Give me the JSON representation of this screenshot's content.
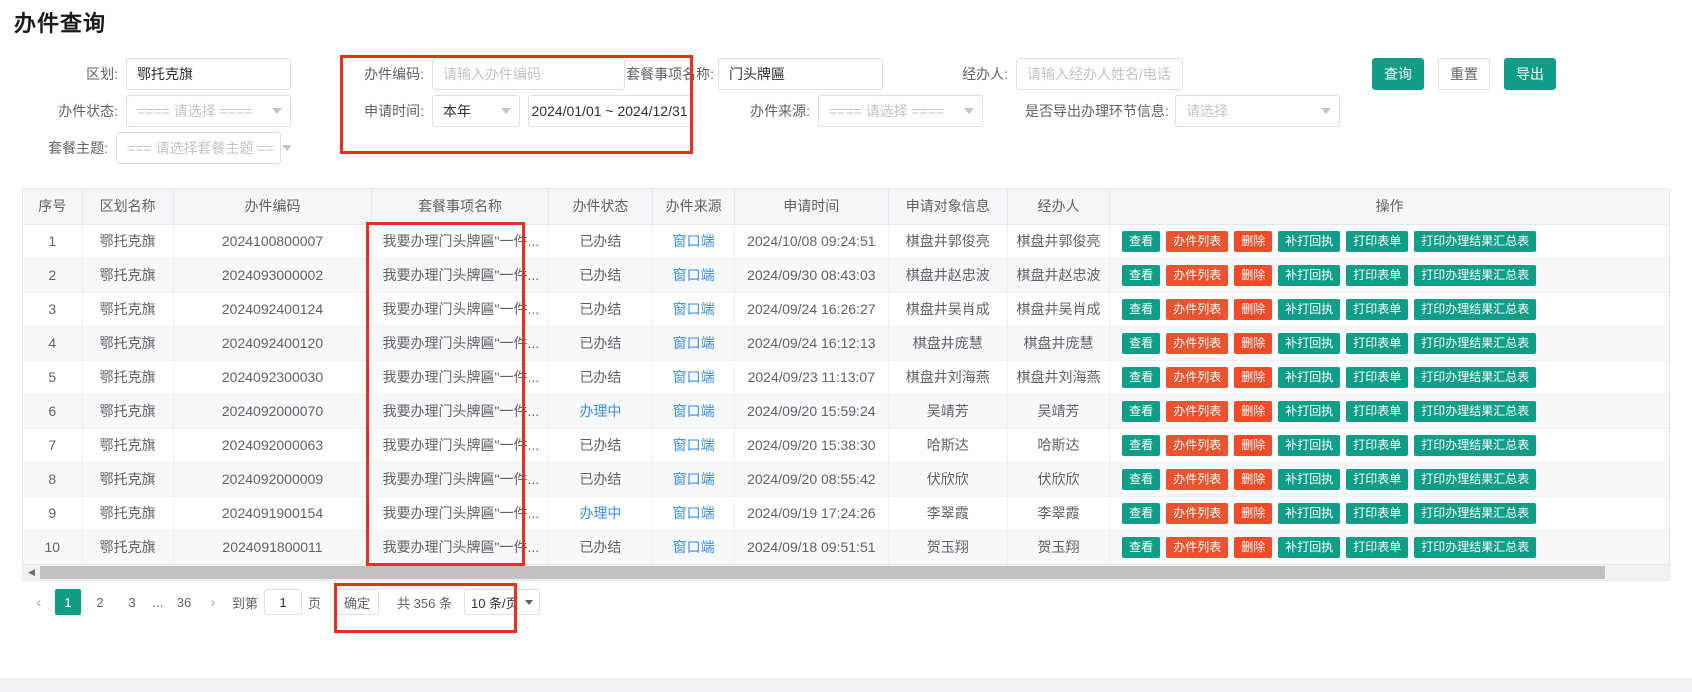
{
  "page": {
    "title": "办件查询"
  },
  "form": {
    "region": {
      "label": "区划:",
      "value": "鄂托克旗"
    },
    "case_code": {
      "label": "办件编码:",
      "placeholder": "请输入办件编码",
      "value": ""
    },
    "item_name": {
      "label": "套餐事项名称:",
      "value": "门头牌匾"
    },
    "handler": {
      "label": "经办人:",
      "placeholder": "请输入经办人姓名/电话",
      "value": ""
    },
    "case_status": {
      "label": "办件状态:",
      "value": "==== 请选择 ===="
    },
    "apply_time": {
      "label": "申请时间:",
      "preset": "本年",
      "range": "2024/01/01 ~ 2024/12/31"
    },
    "case_source": {
      "label": "办件来源:",
      "value": "==== 请选择 ===="
    },
    "export_steps": {
      "label": "是否导出办理环节信息:",
      "value": "请选择"
    },
    "package_theme": {
      "label": "套餐主题:",
      "value": "=== 请选择套餐主题 =="
    },
    "buttons": {
      "search": "查询",
      "reset": "重置",
      "export": "导出"
    }
  },
  "table": {
    "headers": [
      "序号",
      "区划名称",
      "办件编码",
      "套餐事项名称",
      "办件状态",
      "办件来源",
      "申请时间",
      "申请对象信息",
      "经办人",
      "操作"
    ],
    "action_labels": [
      "查看",
      "办件列表",
      "删除",
      "补打回执",
      "打印表单",
      "打印办理结果汇总表"
    ],
    "rows": [
      {
        "no": "1",
        "region": "鄂托克旗",
        "code": "2024100800007",
        "item": "我要办理门头牌匾\"一件...",
        "status": "已办结",
        "source": "窗口端",
        "time": "2024/10/08 09:24:51",
        "applicant": "棋盘井郭俊亮",
        "handler": "棋盘井郭俊亮"
      },
      {
        "no": "2",
        "region": "鄂托克旗",
        "code": "2024093000002",
        "item": "我要办理门头牌匾\"一件...",
        "status": "已办结",
        "source": "窗口端",
        "time": "2024/09/30 08:43:03",
        "applicant": "棋盘井赵忠波",
        "handler": "棋盘井赵忠波"
      },
      {
        "no": "3",
        "region": "鄂托克旗",
        "code": "2024092400124",
        "item": "我要办理门头牌匾\"一件...",
        "status": "已办结",
        "source": "窗口端",
        "time": "2024/09/24 16:26:27",
        "applicant": "棋盘井吴肖成",
        "handler": "棋盘井吴肖成"
      },
      {
        "no": "4",
        "region": "鄂托克旗",
        "code": "2024092400120",
        "item": "我要办理门头牌匾\"一件...",
        "status": "已办结",
        "source": "窗口端",
        "time": "2024/09/24 16:12:13",
        "applicant": "棋盘井庞慧",
        "handler": "棋盘井庞慧"
      },
      {
        "no": "5",
        "region": "鄂托克旗",
        "code": "2024092300030",
        "item": "我要办理门头牌匾\"一件...",
        "status": "已办结",
        "source": "窗口端",
        "time": "2024/09/23 11:13:07",
        "applicant": "棋盘井刘海燕",
        "handler": "棋盘井刘海燕"
      },
      {
        "no": "6",
        "region": "鄂托克旗",
        "code": "2024092000070",
        "item": "我要办理门头牌匾\"一件...",
        "status": "办理中",
        "source": "窗口端",
        "time": "2024/09/20 15:59:24",
        "applicant": "吴靖芳",
        "handler": "吴靖芳"
      },
      {
        "no": "7",
        "region": "鄂托克旗",
        "code": "2024092000063",
        "item": "我要办理门头牌匾\"一件...",
        "status": "已办结",
        "source": "窗口端",
        "time": "2024/09/20 15:38:30",
        "applicant": "哈斯达",
        "handler": "哈斯达"
      },
      {
        "no": "8",
        "region": "鄂托克旗",
        "code": "2024092000009",
        "item": "我要办理门头牌匾\"一件...",
        "status": "已办结",
        "source": "窗口端",
        "time": "2024/09/20 08:55:42",
        "applicant": "伏欣欣",
        "handler": "伏欣欣"
      },
      {
        "no": "9",
        "region": "鄂托克旗",
        "code": "2024091900154",
        "item": "我要办理门头牌匾\"一件...",
        "status": "办理中",
        "source": "窗口端",
        "time": "2024/09/19 17:24:26",
        "applicant": "李翠霞",
        "handler": "李翠霞"
      },
      {
        "no": "10",
        "region": "鄂托克旗",
        "code": "2024091800011",
        "item": "我要办理门头牌匾\"一件...",
        "status": "已办结",
        "source": "窗口端",
        "time": "2024/09/18 09:51:51",
        "applicant": "贺玉翔",
        "handler": "贺玉翔"
      }
    ]
  },
  "pagination": {
    "prev": "‹",
    "next": "›",
    "pages": [
      "1",
      "2",
      "3"
    ],
    "dots": "...",
    "last_page": "36",
    "goto_prefix": "到第",
    "goto_value": "1",
    "goto_suffix": "页",
    "confirm": "确定",
    "total": "共 356 条",
    "page_size": "10 条/页"
  },
  "colors": {
    "primary": "#119e88",
    "orange": "#e8542f",
    "red": "#ef4b28",
    "link": "#3a8ee6",
    "annotation": "#e8301a"
  }
}
